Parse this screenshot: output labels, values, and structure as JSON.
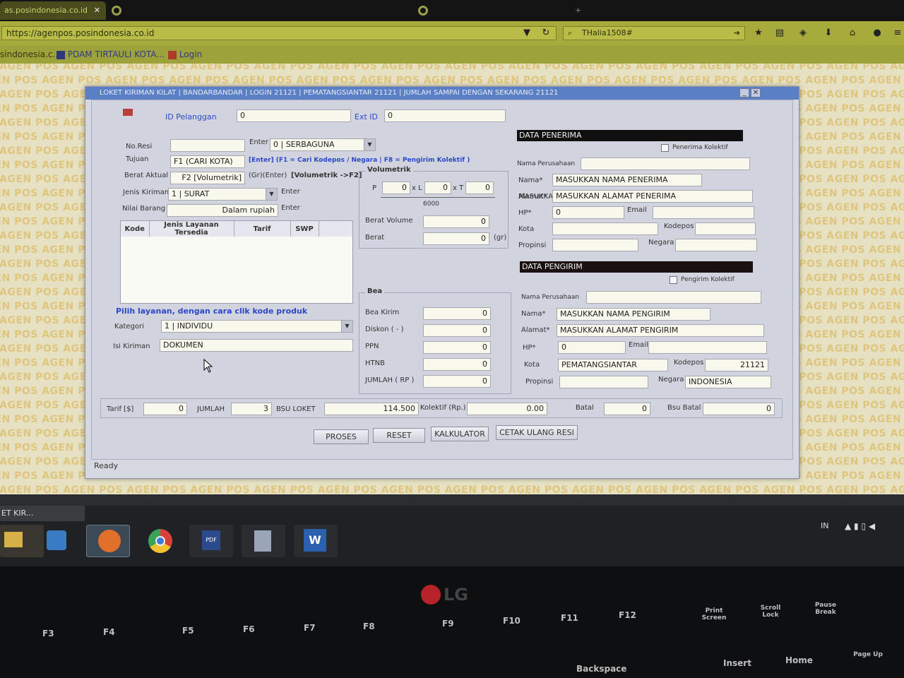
{
  "browser": {
    "tab_active": "as.posindonesia.co.id",
    "url": "https://agenpos.posindonesia.co.id",
    "search": "THalia1508#",
    "bookmarks": [
      "sindonesia.c...",
      "PDAM TIRTAULI KOTA...",
      "Login"
    ]
  },
  "watermark": "POS AGEN",
  "app": {
    "title": "LOKET KIRIMAN KILAT | BANDARBANDAR | LOGIN 21121 | PEMATANGSIANTAR 21121 | JUMLAH SAMPAI DENGAN SEKARANG 21121",
    "id_pelanggan_label": "ID Pelanggan",
    "id_pelanggan_value": "0",
    "ext_id_label": "Ext ID",
    "ext_id_value": "0",
    "left": {
      "no_resi_label": "No.Resi",
      "enter_label": "Enter",
      "serbaguna_value": "0 | SERBAGUNA",
      "tujuan_label": "Tujuan",
      "tujuan_value": "F1 (CARI KOTA)",
      "tujuan_hint": "[Enter] (F1 = Cari Kodepos / Negara | F8 = Pengirim Kolektif )",
      "berat_aktual_label": "Berat Aktual",
      "berat_aktual_value": "F2 [Volumetrik]",
      "berat_hint": "(Gr)(Enter)",
      "volumetrik_hint": "[Volumetrik ->F2]",
      "jenis_kiriman_label": "Jenis Kiriman",
      "jenis_kiriman_value": "1 | SURAT",
      "jenis_enter": "Enter",
      "nilai_barang_label": "Nilai Barang",
      "nilai_barang_value": "Dalam rupiah",
      "nilai_enter": "Enter",
      "table_headers": [
        "Kode",
        "Jenis Layanan Tersedia",
        "Tarif",
        "SWP"
      ],
      "pilih_hint": "Pilih layanan, dengan cara clik kode produk",
      "kategori_label": "Kategori",
      "kategori_value": "1 | INDIVIDU",
      "isi_kiriman_label": "Isi Kiriman",
      "isi_kiriman_value": "DOKUMEN"
    },
    "volumetrik": {
      "title": "Volumetrik",
      "p_label": "P",
      "p_value": "0",
      "xl_label": "x L",
      "l_value": "0",
      "xt_label": "x T",
      "t_value": "0",
      "divisor": "6000",
      "berat_volume_label": "Berat Volume",
      "berat_volume_value": "0",
      "berat_label": "Berat",
      "berat_value": "0",
      "berat_unit": "(gr)"
    },
    "bea": {
      "title": "Bea",
      "rows": [
        {
          "label": "Bea Kirim",
          "value": "0"
        },
        {
          "label": "Diskon ( - )",
          "value": "0"
        },
        {
          "label": "PPN",
          "value": "0"
        },
        {
          "label": "HTNB",
          "value": "0"
        },
        {
          "label": "JUMLAH ( RP )",
          "value": "0"
        }
      ]
    },
    "penerima": {
      "title": "DATA PENERIMA",
      "kolektif_label": "Penerima Kolektif",
      "perusahaan_label": "Nama Perusahaan",
      "nama_label": "Nama*",
      "nama_value": "MASUKKAN NAMA PENERIMA",
      "alamat_label": "Alamat*",
      "alamat_value": "MASUKKAN ALAMAT PENERIMA",
      "hp_label": "HP*",
      "hp_value": "0",
      "email_label": "Email",
      "kota_label": "Kota",
      "kodepos_label": "Kodepos",
      "propinsi_label": "Propinsi",
      "negara_label": "Negara"
    },
    "pengirim": {
      "title": "DATA PENGIRIM",
      "kolektif_label": "Pengirim Kolektif",
      "perusahaan_label": "Nama Perusahaan",
      "nama_label": "Nama*",
      "nama_value": "MASUKKAN NAMA PENGIRIM",
      "alamat_label": "Alamat*",
      "alamat_value": "MASUKKAN ALAMAT PENGIRIM",
      "hp_label": "HP*",
      "hp_value": "0",
      "email_label": "Email",
      "kota_label": "Kota",
      "kota_value": "PEMATANGSIANTAR",
      "kodepos_label": "Kodepos",
      "kodepos_value": "21121",
      "propinsi_label": "Propinsi",
      "negara_label": "Negara",
      "negara_value": "INDONESIA"
    },
    "bottom": {
      "tarif_label": "Tarif [$]",
      "tarif_value": "0",
      "jumlah_label": "JUMLAH",
      "jumlah_value": "3",
      "bsu_loket_label": "BSU LOKET",
      "bsu_loket_value": "114.500",
      "kolektif_label": "Kolektif (Rp.)",
      "kolektif_value": "0.00",
      "batal_label": "Batal",
      "batal_value": "0",
      "bsu_batal_label": "Bsu Batal",
      "bsu_batal_value": "0"
    },
    "buttons": {
      "proses": "PROSES",
      "reset": "RESET",
      "kalkulator": "KALKULATOR",
      "cetak": "CETAK ULANG RESI"
    },
    "status": "Ready"
  },
  "taskbar": {
    "preview_label": "ET KIR...",
    "lang": "IN"
  },
  "keyboard": {
    "brand": "LG",
    "keys": [
      "F3",
      "F4",
      "F5",
      "F6",
      "F7",
      "F8",
      "F9",
      "F10",
      "F11",
      "F12",
      "Print Screen",
      "Scroll Lock",
      "Pause Break",
      "Backspace",
      "Insert",
      "Home",
      "Page Up"
    ]
  }
}
